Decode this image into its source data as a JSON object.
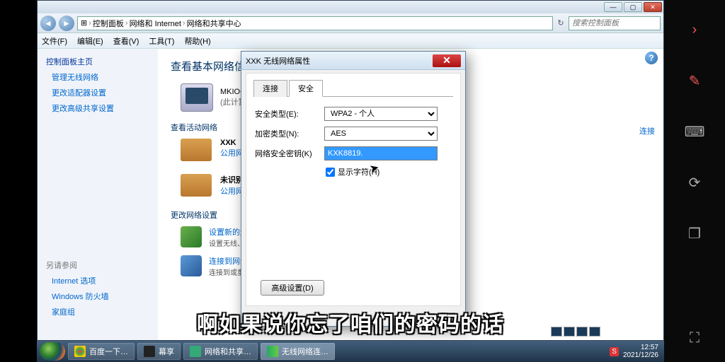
{
  "window": {
    "breadcrumb": [
      "控制面板",
      "网络和 Internet",
      "网络和共享中心"
    ],
    "search_placeholder": "搜索控制面板",
    "menus": [
      "文件(F)",
      "编辑(E)",
      "查看(V)",
      "工具(T)",
      "帮助(H)"
    ]
  },
  "sidebar": {
    "home": "控制面板主页",
    "links": [
      "管理无线网络",
      "更改适配器设置",
      "更改高级共享设置"
    ],
    "related_title": "另请参阅",
    "related": [
      "Internet 选项",
      "Windows 防火墙",
      "家庭组"
    ]
  },
  "main": {
    "title": "查看基本网络信息",
    "computer_name": "MKIOODGXUOJAX",
    "computer_sub": "(此计算机)",
    "active_head": "查看活动网络",
    "net1_name": "XXK",
    "net1_type": "公用网络",
    "net2_name": "未识别的网",
    "net2_type": "公用网络",
    "right_link": "连接",
    "change_head": "更改网络设置",
    "act1_t": "设置新的连接",
    "act1_s": "设置无线、宽",
    "act2_t": "连接到网络",
    "act2_s": "连接到或重新连"
  },
  "dialog": {
    "title": "XXK 无线网络属性",
    "tab1": "连接",
    "tab2": "安全",
    "lbl_sectype": "安全类型(E):",
    "val_sectype": "WPA2 - 个人",
    "lbl_enc": "加密类型(N):",
    "val_enc": "AES",
    "lbl_key": "网络安全密钥(K)",
    "val_key": "KXK8819.",
    "chk_show": "显示字符(H)",
    "adv_btn": "高级设置(D)"
  },
  "taskbar": {
    "items": [
      "百度一下…",
      "幕享",
      "网络和共享…",
      "无线网络连…"
    ],
    "time": "12:57",
    "date": "2021/12/26"
  },
  "subtitle": "啊如果说你忘了咱们的密码的话"
}
